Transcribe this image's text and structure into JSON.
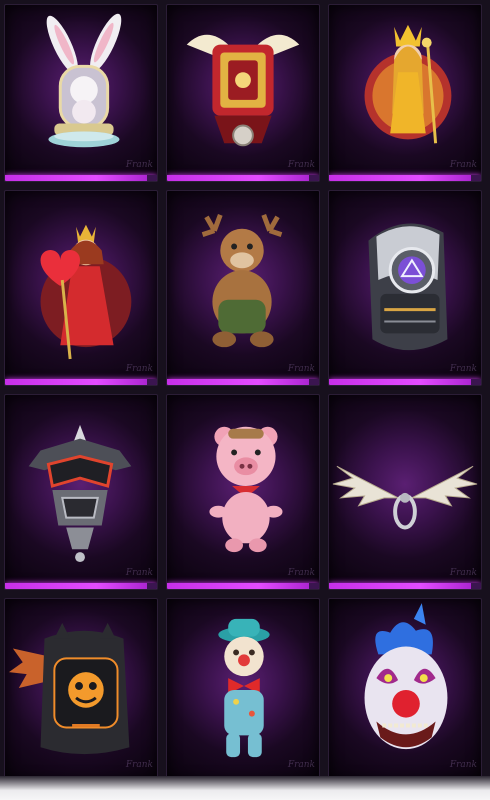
{
  "screen": {
    "background": "#17101d",
    "rarity_color": "#d23cf5"
  },
  "inventory": {
    "items": [
      {
        "art": "bunny-shrine-backpack",
        "rarity": "mythic",
        "watermark": "Frank"
      },
      {
        "art": "winged-mech-backpack",
        "rarity": "mythic",
        "watermark": "Frank"
      },
      {
        "art": "crowned-queen-backpack",
        "rarity": "mythic",
        "watermark": "Frank"
      },
      {
        "art": "red-queen-heart-backpack",
        "rarity": "mythic",
        "watermark": "Frank"
      },
      {
        "art": "reindeer-plush-backpack",
        "rarity": "mythic",
        "watermark": "Frank"
      },
      {
        "art": "tech-pod-backpack",
        "rarity": "mythic",
        "watermark": "Frank"
      },
      {
        "art": "demon-armor-backpack",
        "rarity": "mythic",
        "watermark": "Frank"
      },
      {
        "art": "pig-plush-backpack",
        "rarity": "mythic",
        "watermark": "Frank"
      },
      {
        "art": "blade-wings-backpack",
        "rarity": "mythic",
        "watermark": "Frank"
      },
      {
        "art": "bat-pumpkin-backpack",
        "rarity": "mythic",
        "watermark": "Frank"
      },
      {
        "art": "clown-doll-backpack",
        "rarity": "mythic",
        "watermark": "Frank"
      },
      {
        "art": "clown-mask-backpack",
        "rarity": "mythic",
        "watermark": "Frank"
      }
    ]
  }
}
